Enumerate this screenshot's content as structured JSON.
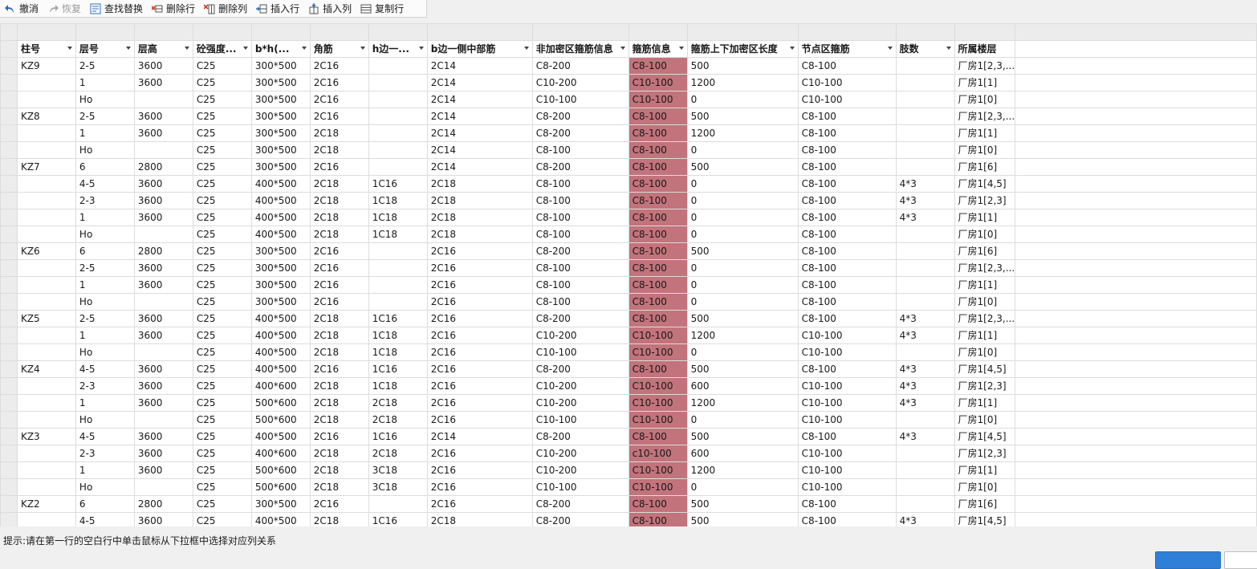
{
  "toolbar": {
    "undo": "撤消",
    "redo": "恢复",
    "find_replace": "查找替换",
    "delete_row": "删除行",
    "delete_col": "删除列",
    "insert_row": "插入行",
    "insert_col": "插入列",
    "copy_row": "复制行"
  },
  "columns": [
    "柱号",
    "层号",
    "层高",
    "砼强度...",
    "b*h(...",
    "角筋",
    "h边一...",
    "b边一侧中部筋",
    "非加密区箍筋信息",
    "箍筋信息",
    "箍筋上下加密区长度",
    "节点区箍筋",
    "肢数",
    "所属楼层"
  ],
  "rows": [
    [
      "KZ9",
      "2-5",
      "3600",
      "C25",
      "300*500",
      "2C16",
      "",
      "2C14",
      "C8-200",
      "C8-100",
      "500",
      "C8-100",
      "",
      "厂房1[2,3,..."
    ],
    [
      "",
      "1",
      "3600",
      "C25",
      "300*500",
      "2C16",
      "",
      "2C14",
      "C10-200",
      "C10-100",
      "1200",
      "C10-100",
      "",
      "厂房1[1]"
    ],
    [
      "",
      "Ho",
      "",
      "C25",
      "300*500",
      "2C16",
      "",
      "2C14",
      "C10-100",
      "C10-100",
      "0",
      "C10-100",
      "",
      "厂房1[0]"
    ],
    [
      "KZ8",
      "2-5",
      "3600",
      "C25",
      "300*500",
      "2C16",
      "",
      "2C14",
      "C8-200",
      "C8-100",
      "500",
      "C8-100",
      "",
      "厂房1[2,3,..."
    ],
    [
      "",
      "1",
      "3600",
      "C25",
      "300*500",
      "2C18",
      "",
      "2C14",
      "C8-200",
      "C8-100",
      "1200",
      "C8-100",
      "",
      "厂房1[1]"
    ],
    [
      "",
      "Ho",
      "",
      "C25",
      "300*500",
      "2C18",
      "",
      "2C14",
      "C8-100",
      "C8-100",
      "0",
      "C8-100",
      "",
      "厂房1[0]"
    ],
    [
      "KZ7",
      "6",
      "2800",
      "C25",
      "300*500",
      "2C16",
      "",
      "2C14",
      "C8-200",
      "C8-100",
      "500",
      "C8-100",
      "",
      "厂房1[6]"
    ],
    [
      "",
      "4-5",
      "3600",
      "C25",
      "400*500",
      "2C18",
      "1C16",
      "2C18",
      "C8-100",
      "C8-100",
      "0",
      "C8-100",
      "4*3",
      "厂房1[4,5]"
    ],
    [
      "",
      "2-3",
      "3600",
      "C25",
      "400*500",
      "2C18",
      "1C18",
      "2C18",
      "C8-100",
      "C8-100",
      "0",
      "C8-100",
      "4*3",
      "厂房1[2,3]"
    ],
    [
      "",
      "1",
      "3600",
      "C25",
      "400*500",
      "2C18",
      "1C18",
      "2C18",
      "C8-100",
      "C8-100",
      "0",
      "C8-100",
      "4*3",
      "厂房1[1]"
    ],
    [
      "",
      "Ho",
      "",
      "C25",
      "400*500",
      "2C18",
      "1C18",
      "2C18",
      "C8-100",
      "C8-100",
      "0",
      "C8-100",
      "",
      "厂房1[0]"
    ],
    [
      "KZ6",
      "6",
      "2800",
      "C25",
      "300*500",
      "2C16",
      "",
      "2C16",
      "C8-200",
      "C8-100",
      "500",
      "C8-100",
      "",
      "厂房1[6]"
    ],
    [
      "",
      "2-5",
      "3600",
      "C25",
      "300*500",
      "2C16",
      "",
      "2C16",
      "C8-100",
      "C8-100",
      "0",
      "C8-100",
      "",
      "厂房1[2,3,..."
    ],
    [
      "",
      "1",
      "3600",
      "C25",
      "300*500",
      "2C16",
      "",
      "2C16",
      "C8-100",
      "C8-100",
      "0",
      "C8-100",
      "",
      "厂房1[1]"
    ],
    [
      "",
      "Ho",
      "",
      "C25",
      "300*500",
      "2C16",
      "",
      "2C16",
      "C8-100",
      "C8-100",
      "0",
      "C8-100",
      "",
      "厂房1[0]"
    ],
    [
      "KZ5",
      "2-5",
      "3600",
      "C25",
      "400*500",
      "2C18",
      "1C16",
      "2C16",
      "C8-200",
      "C8-100",
      "500",
      "C8-100",
      "4*3",
      "厂房1[2,3,..."
    ],
    [
      "",
      "1",
      "3600",
      "C25",
      "400*500",
      "2C18",
      "1C18",
      "2C16",
      "C10-200",
      "C10-100",
      "1200",
      "C10-100",
      "4*3",
      "厂房1[1]"
    ],
    [
      "",
      "Ho",
      "",
      "C25",
      "400*500",
      "2C18",
      "1C18",
      "2C16",
      "C10-100",
      "C10-100",
      "0",
      "C10-100",
      "",
      "厂房1[0]"
    ],
    [
      "KZ4",
      "4-5",
      "3600",
      "C25",
      "400*500",
      "2C16",
      "1C16",
      "2C16",
      "C8-200",
      "C8-100",
      "500",
      "C8-100",
      "4*3",
      "厂房1[4,5]"
    ],
    [
      "",
      "2-3",
      "3600",
      "C25",
      "400*600",
      "2C18",
      "1C18",
      "2C16",
      "C10-200",
      "C10-100",
      "600",
      "C10-100",
      "4*3",
      "厂房1[2,3]"
    ],
    [
      "",
      "1",
      "3600",
      "C25",
      "500*600",
      "2C18",
      "2C18",
      "2C16",
      "C10-200",
      "C10-100",
      "1200",
      "C10-100",
      "4*3",
      "厂房1[1]"
    ],
    [
      "",
      "Ho",
      "",
      "C25",
      "500*600",
      "2C18",
      "2C18",
      "2C16",
      "C10-100",
      "C10-100",
      "0",
      "C10-100",
      "",
      "厂房1[0]"
    ],
    [
      "KZ3",
      "4-5",
      "3600",
      "C25",
      "400*500",
      "2C16",
      "1C16",
      "2C14",
      "C8-200",
      "C8-100",
      "500",
      "C8-100",
      "4*3",
      "厂房1[4,5]"
    ],
    [
      "",
      "2-3",
      "3600",
      "C25",
      "400*600",
      "2C18",
      "2C18",
      "2C16",
      "C10-200",
      "c10-100",
      "600",
      "C10-100",
      "",
      "厂房1[2,3]"
    ],
    [
      "",
      "1",
      "3600",
      "C25",
      "500*600",
      "2C18",
      "3C18",
      "2C16",
      "C10-200",
      "C10-100",
      "1200",
      "C10-100",
      "",
      "厂房1[1]"
    ],
    [
      "",
      "Ho",
      "",
      "C25",
      "500*600",
      "2C18",
      "3C18",
      "2C16",
      "C10-100",
      "C10-100",
      "0",
      "C10-100",
      "",
      "厂房1[0]"
    ],
    [
      "KZ2",
      "6",
      "2800",
      "C25",
      "300*500",
      "2C16",
      "",
      "2C16",
      "C8-200",
      "C8-100",
      "500",
      "C8-100",
      "",
      "厂房1[6]"
    ],
    [
      "",
      "4-5",
      "3600",
      "C25",
      "400*500",
      "2C18",
      "1C16",
      "2C18",
      "C8-200",
      "C8-100",
      "500",
      "C8-100",
      "4*3",
      "厂房1[4,5]"
    ]
  ],
  "highlight_color": "#c2737b",
  "status_text": "提示:请在第一行的空白行中单击鼠标从下拉框中选择对应列关系",
  "buttons": {
    "ok": "",
    "cancel": ""
  }
}
